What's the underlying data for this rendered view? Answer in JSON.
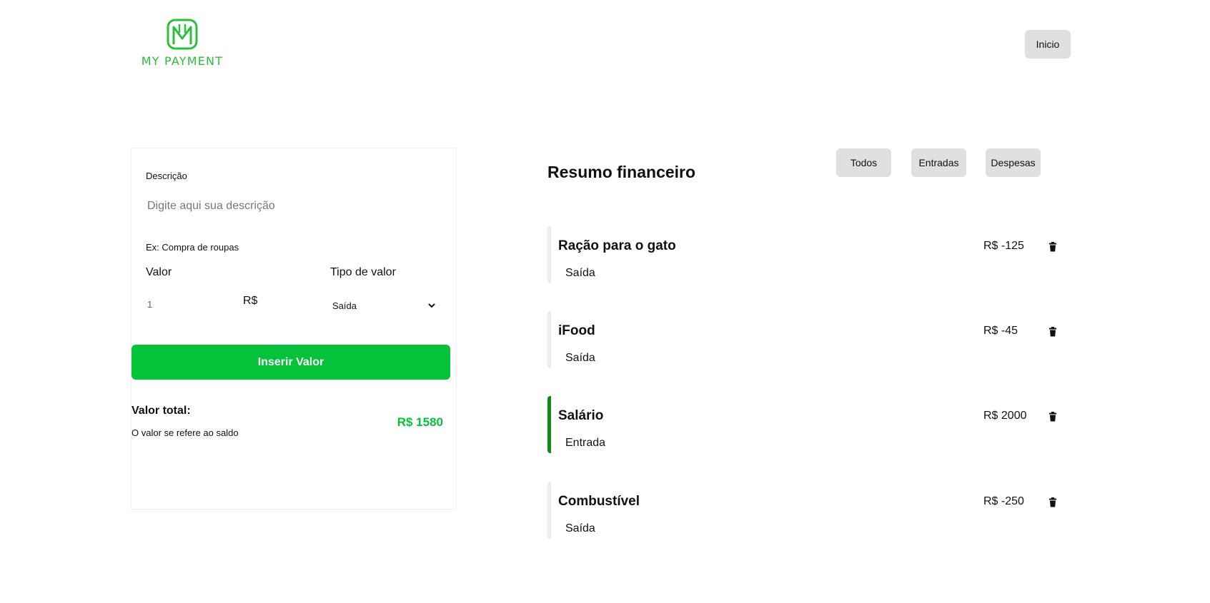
{
  "brand": {
    "name": "MY PAYMENT",
    "color": "#28c23a"
  },
  "nav": {
    "home_label": "Inicio"
  },
  "form": {
    "description_label": "Descrição",
    "description_placeholder": "Digite aqui sua descrição",
    "description_hint": "Ex: Compra de roupas",
    "value_label": "Valor",
    "value_input": "1",
    "currency": "R$",
    "type_label": "Tipo de valor",
    "type_selected": "Saída",
    "submit_label": "Inserir Valor",
    "accent_color": "#04c23a"
  },
  "total": {
    "label": "Valor total:",
    "note": "O valor se refere ao saldo",
    "value": "R$ 1580"
  },
  "summary": {
    "title": "Resumo financeiro",
    "filters": [
      "Todos",
      "Entradas",
      "Despesas"
    ],
    "entries": [
      {
        "title": "Ração para o gato",
        "type": "Saída",
        "amount": "R$ -125"
      },
      {
        "title": "iFood",
        "type": "Saída",
        "amount": "R$ -45"
      },
      {
        "title": "Salário",
        "type": "Entrada",
        "amount": "R$ 2000"
      },
      {
        "title": "Combustível",
        "type": "Saída",
        "amount": "R$ -250"
      }
    ]
  },
  "icons": {
    "entry_delete": "trash-icon",
    "select_toggle": "chevron-down-icon",
    "logo": "logo-m-icon"
  }
}
